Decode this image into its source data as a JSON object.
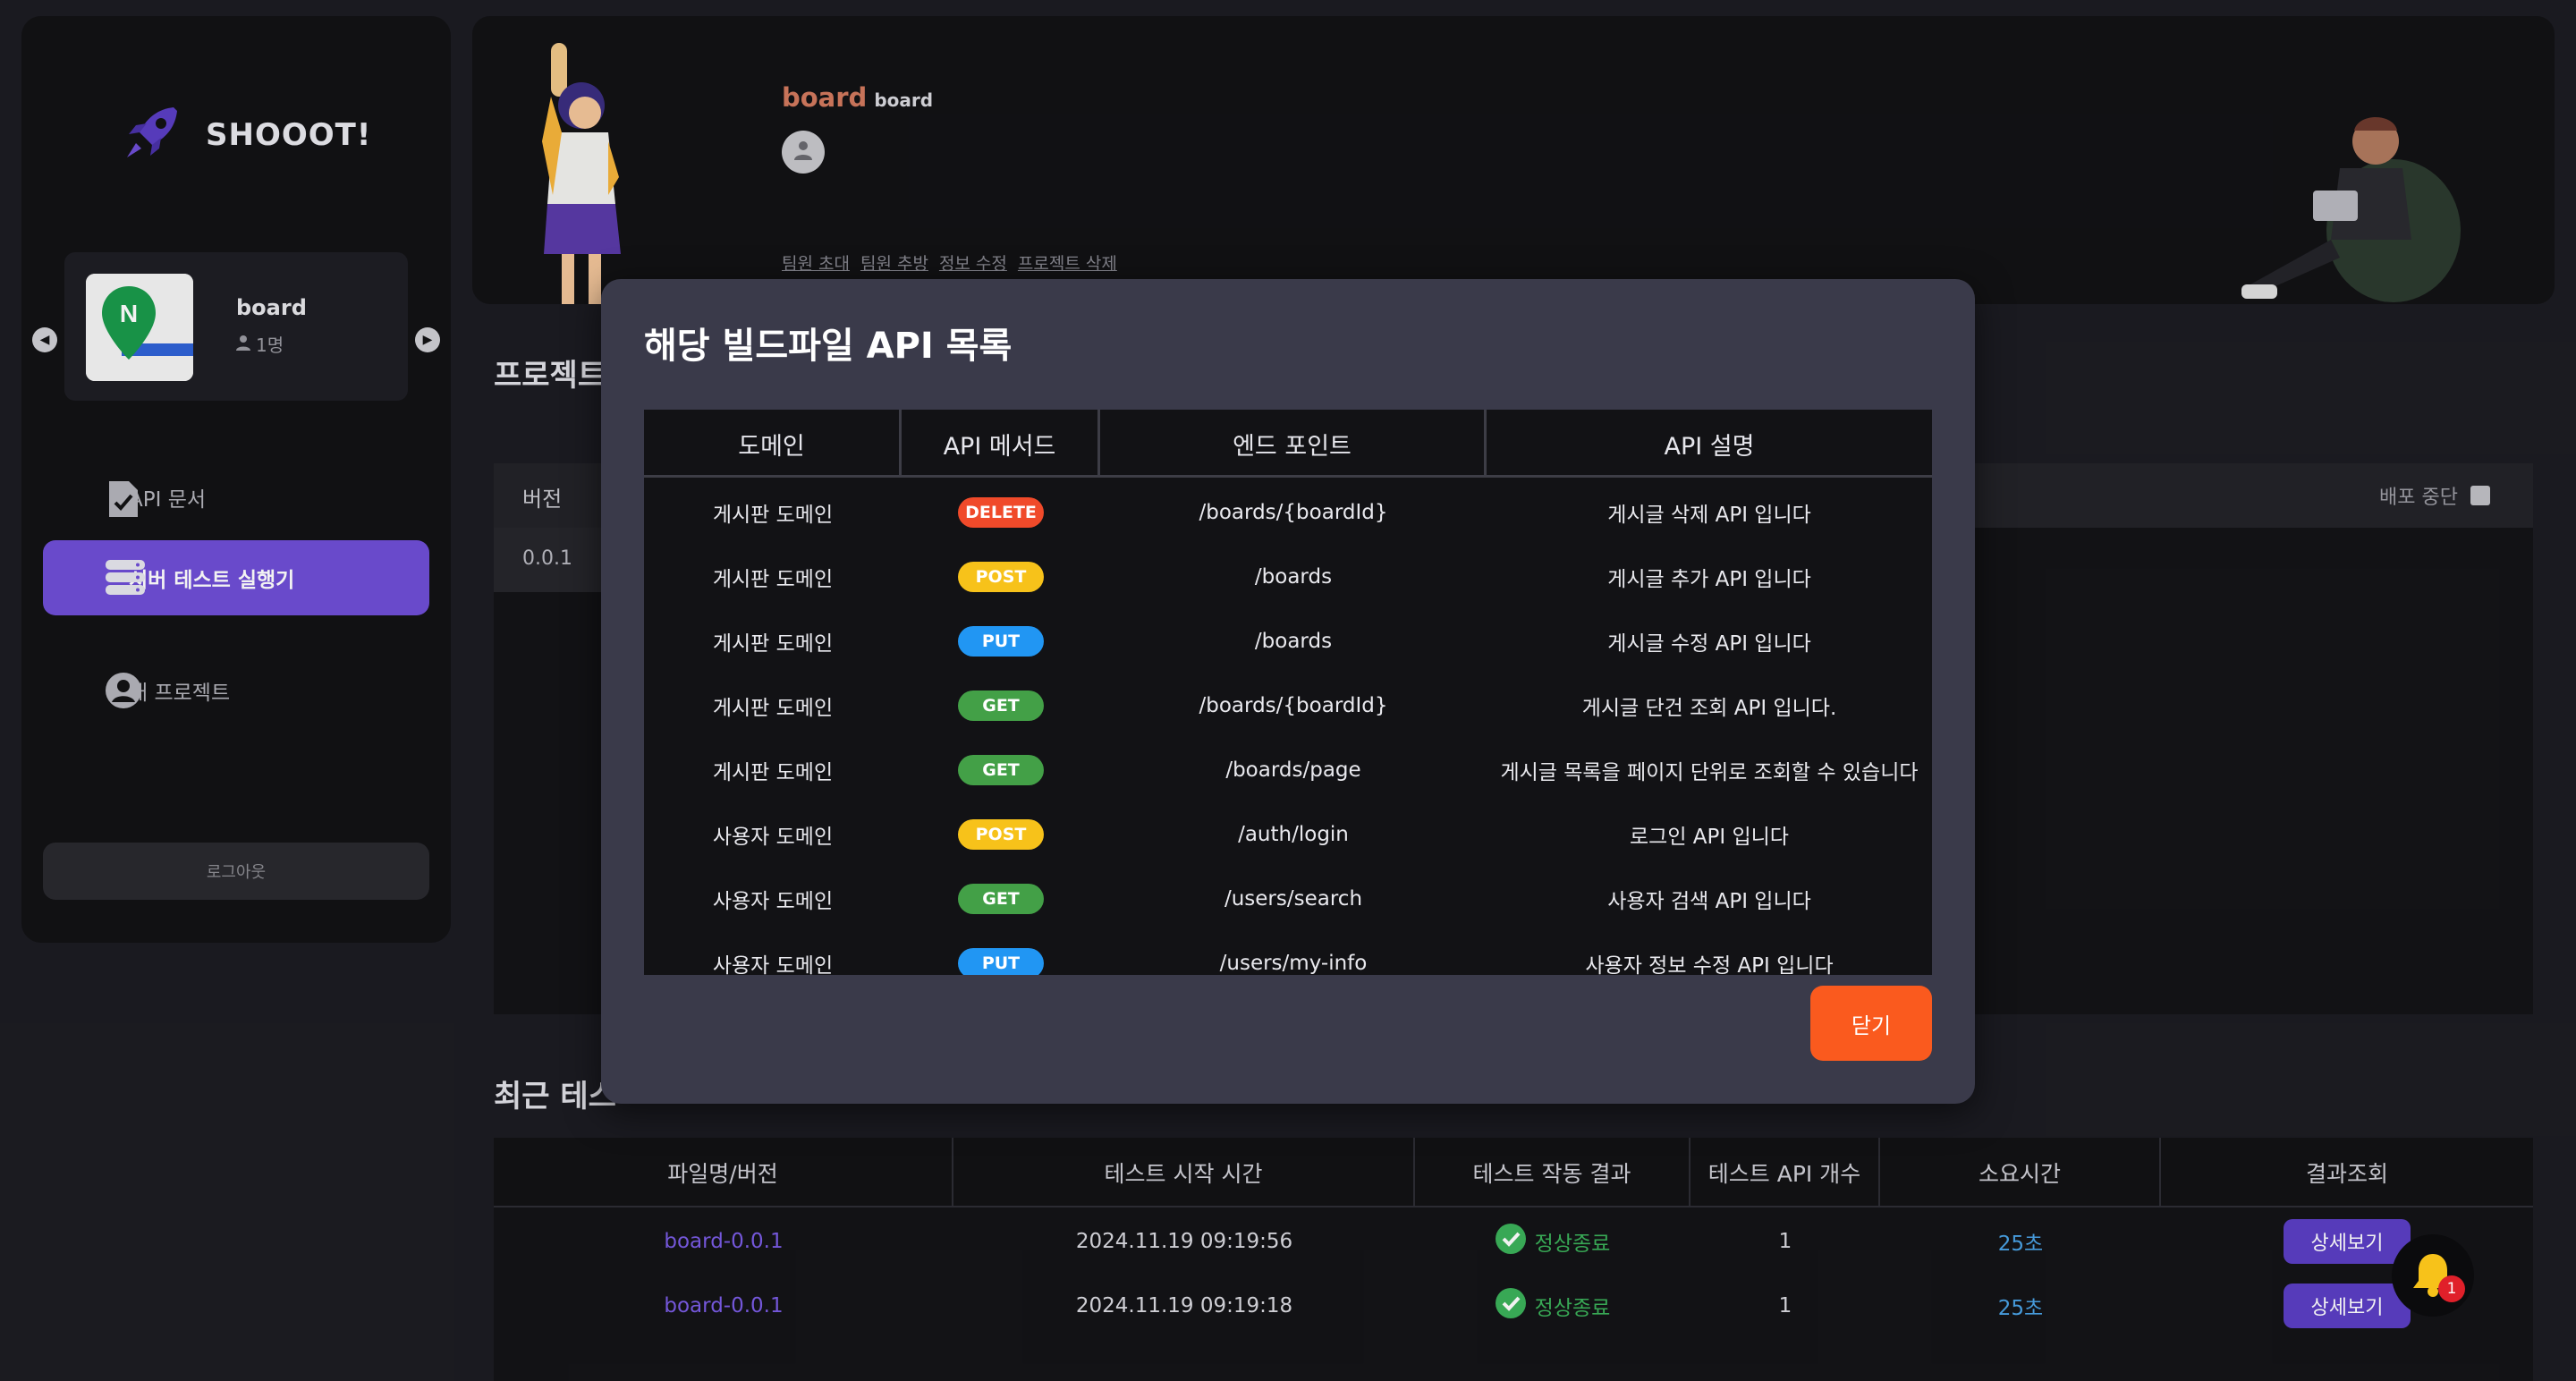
{
  "app": {
    "name": "SHOOOT!"
  },
  "sidebar": {
    "project": {
      "name": "board",
      "members": "1명"
    },
    "nav": [
      {
        "label": "API 문서",
        "icon": "document-check-icon"
      },
      {
        "label": "서버 테스트 실행기",
        "icon": "server-icon"
      },
      {
        "label": "내 프로젝트",
        "icon": "user-circle-icon"
      }
    ],
    "logout": "로그아웃"
  },
  "header": {
    "title": "board",
    "subtitle": "board",
    "links": [
      "팀원 초대",
      "팀원 추방",
      "정보 수정",
      "프로젝트 삭제"
    ]
  },
  "background": {
    "project_section_title": "프로젝트",
    "version_col": "버전",
    "version_value": "0.0.1",
    "stop_label": "배포 중단",
    "recent_title": "최근 테스",
    "recent_columns": [
      "파일명/버전",
      "테스트 시작 시간",
      "테스트 작동 결과",
      "테스트 API 개수",
      "소요시간",
      "결과조회"
    ],
    "recent_rows": [
      {
        "file": "board-0.0.1",
        "start": "2024.11.19 09:19:56",
        "result": "정상종료",
        "count": "1",
        "duration": "25초",
        "action": "상세보기"
      },
      {
        "file": "board-0.0.1",
        "start": "2024.11.19 09:19:18",
        "result": "정상종료",
        "count": "1",
        "duration": "25초",
        "action": "상세보기"
      }
    ]
  },
  "modal": {
    "title": "해당 빌드파일 API 목록",
    "columns": [
      "도메인",
      "API 메서드",
      "엔드 포인트",
      "API 설명"
    ],
    "rows": [
      {
        "domain": "게시판 도메인",
        "method": "DELETE",
        "endpoint": "/boards/{boardId}",
        "description": "게시글 삭제 API 입니다"
      },
      {
        "domain": "게시판 도메인",
        "method": "POST",
        "endpoint": "/boards",
        "description": "게시글 추가 API 입니다"
      },
      {
        "domain": "게시판 도메인",
        "method": "PUT",
        "endpoint": "/boards",
        "description": "게시글 수정 API 입니다"
      },
      {
        "domain": "게시판 도메인",
        "method": "GET",
        "endpoint": "/boards/{boardId}",
        "description": "게시글 단건 조회 API 입니다."
      },
      {
        "domain": "게시판 도메인",
        "method": "GET",
        "endpoint": "/boards/page",
        "description": "게시글 목록을 페이지 단위로 조회할 수 있습니다"
      },
      {
        "domain": "사용자 도메인",
        "method": "POST",
        "endpoint": "/auth/login",
        "description": "로그인 API 입니다"
      },
      {
        "domain": "사용자 도메인",
        "method": "GET",
        "endpoint": "/users/search",
        "description": "사용자 검색 API 입니다"
      },
      {
        "domain": "사용자 도메인",
        "method": "PUT",
        "endpoint": "/users/my-info",
        "description": "사용자 정보 수정 API 입니다"
      }
    ],
    "method_colors": {
      "DELETE": "#f04a2a",
      "POST": "#f7c21a",
      "PUT": "#2196f3",
      "GET": "#43a047"
    },
    "close": "닫기"
  },
  "notifications": {
    "count": "1"
  }
}
